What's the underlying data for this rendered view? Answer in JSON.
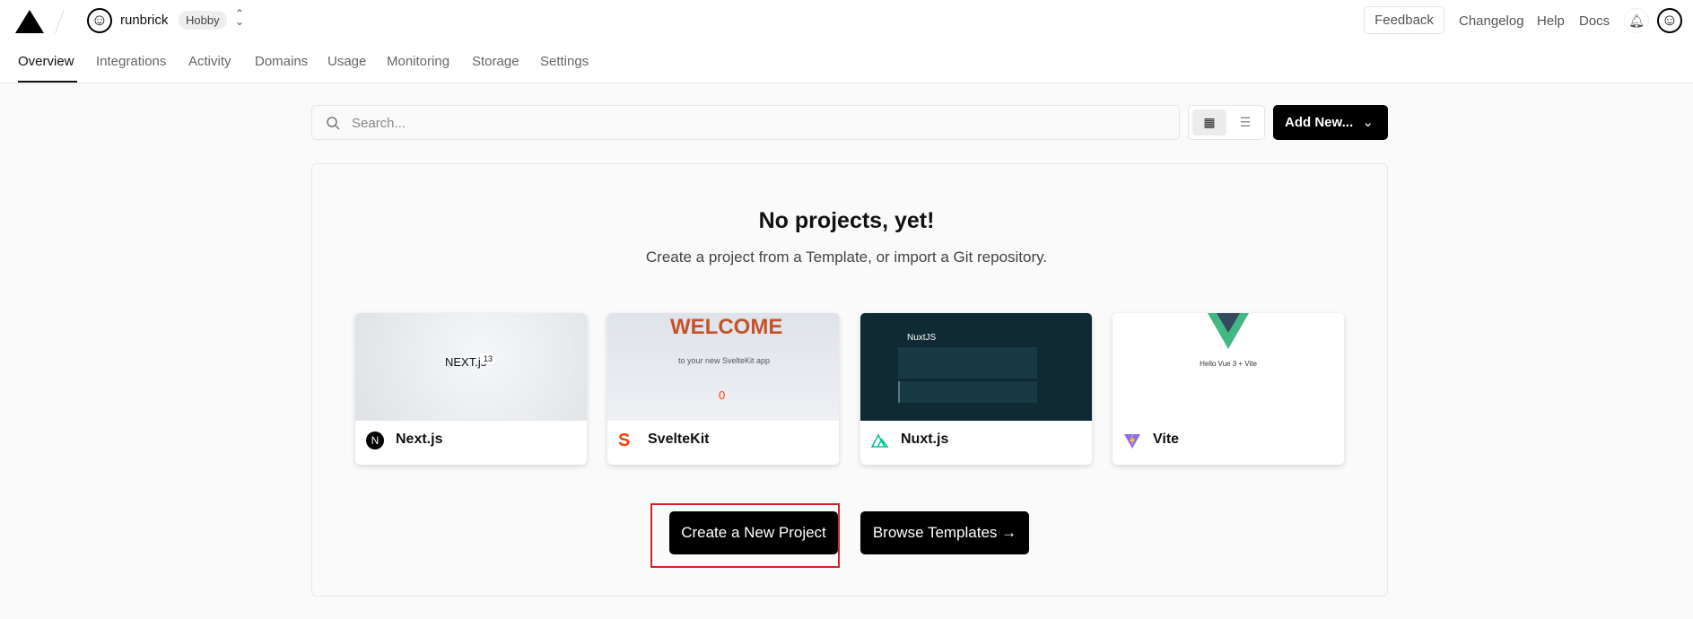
{
  "header": {
    "team": "runbrick",
    "plan": "Hobby",
    "feedback": "Feedback",
    "links": [
      "Changelog",
      "Help",
      "Docs"
    ]
  },
  "tabs": [
    "Overview",
    "Integrations",
    "Activity",
    "Domains",
    "Usage",
    "Monitoring",
    "Storage",
    "Settings"
  ],
  "toolbar": {
    "search_placeholder": "Search...",
    "add_new": "Add New..."
  },
  "empty": {
    "title": "No projects, yet!",
    "subtitle": "Create a project from a Template, or import a Git repository."
  },
  "templates": [
    {
      "name": "Next.js"
    },
    {
      "name": "SvelteKit"
    },
    {
      "name": "Nuxt.js"
    },
    {
      "name": "Vite"
    }
  ],
  "thumbs": {
    "next": "NEXT.js",
    "next_ver": "13",
    "svelte_welcome": "WELCOME",
    "svelte_sub": "to your new SvelteKit app",
    "svelte_count": "0",
    "nuxt": "NuxtJS",
    "vite": "Hello Vue 3 + Vite"
  },
  "actions": {
    "create": "Create a New Project",
    "browse": "Browse Templates →"
  },
  "colors": {
    "primary": "#000000",
    "highlight": "#d0232f",
    "nuxt_bg": "#0f2a33",
    "svelte": "#ff3e00",
    "vue": "#42b883"
  }
}
